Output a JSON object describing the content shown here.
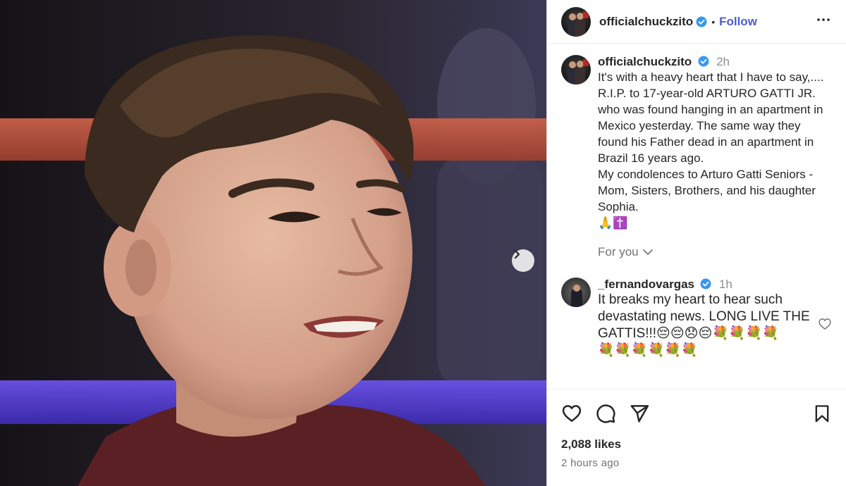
{
  "post": {
    "username": "officialchuckzito",
    "follow_label": "Follow",
    "separator": "•",
    "more_icon": "more-horizontal-icon"
  },
  "caption": {
    "username": "officialchuckzito",
    "time": "2h",
    "text": "It's with a heavy heart that I have to say,.... R.I.P.  to 17-year-old ARTURO GATTI  JR. who was found hanging in an apartment in Mexico yesterday. The same way they found his Father dead in an apartment in Brazil 16 years ago.\nMy condolences to Arturo Gatti Seniors - Mom, Sisters, Brothers, and his daughter Sophia.",
    "emoji_line": "🙏✝️",
    "for_you_label": "For you"
  },
  "comment": {
    "username": "_fernandovargas",
    "time": "1h",
    "text": "It breaks my heart to hear such devastating news. LONG LIVE THE GATTIS!!!😔😔😞😔💐💐💐💐\n💐💐💐💐💐💐"
  },
  "footer": {
    "likes": "2,088 likes",
    "posted_ago": "2 hours ago"
  },
  "colors": {
    "verified": "#3897f0",
    "follow": "#4a5dd6",
    "muted": "#737373",
    "text": "#262626"
  }
}
